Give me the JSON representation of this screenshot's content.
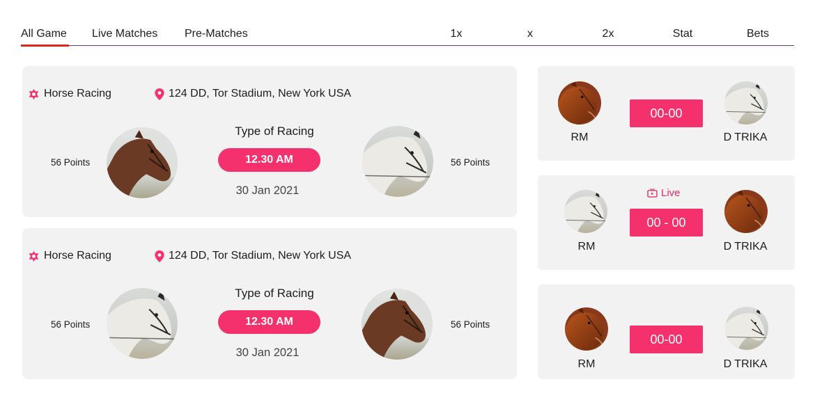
{
  "tabs": [
    {
      "label": "All Game",
      "active": true
    },
    {
      "label": "Live Matches",
      "active": false
    },
    {
      "label": "Pre-Matches",
      "active": false
    }
  ],
  "columns": [
    "1x",
    "x",
    "2x",
    "Stat",
    "Bets"
  ],
  "colors": {
    "accent": "#f4316d",
    "tab_underline": "#e0251f",
    "divider": "#5b3f8c",
    "card_bg": "#f2f2f2"
  },
  "race_cards": [
    {
      "category": "Horse Racing",
      "category_icon": "star-of-david-icon",
      "location": "124 DD, Tor Stadium, New York USA",
      "location_icon": "map-pin-icon",
      "left_points": "56 Points",
      "right_points": "56 Points",
      "left_horse": "brown-horse",
      "right_horse": "white-horse",
      "type_label": "Type of Racing",
      "time": "12.30 AM",
      "date": "30 Jan 2021"
    },
    {
      "category": "Horse Racing",
      "category_icon": "star-of-david-icon",
      "location": "124 DD, Tor Stadium, New York USA",
      "location_icon": "map-pin-icon",
      "left_points": "56 Points",
      "right_points": "56 Points",
      "left_horse": "white-horse",
      "right_horse": "brown-horse",
      "type_label": "Type of Racing",
      "time": "12.30 AM",
      "date": "30 Jan 2021"
    }
  ],
  "matches": [
    {
      "left": "RM",
      "right": "D TRIKA",
      "score": "00-00",
      "live": false
    },
    {
      "left": "RM",
      "right": "D TRIKA",
      "score": "00 - 00",
      "live": true,
      "live_label": "Live"
    },
    {
      "left": "RM",
      "right": "D TRIKA",
      "score": "00-00",
      "live": false
    }
  ]
}
